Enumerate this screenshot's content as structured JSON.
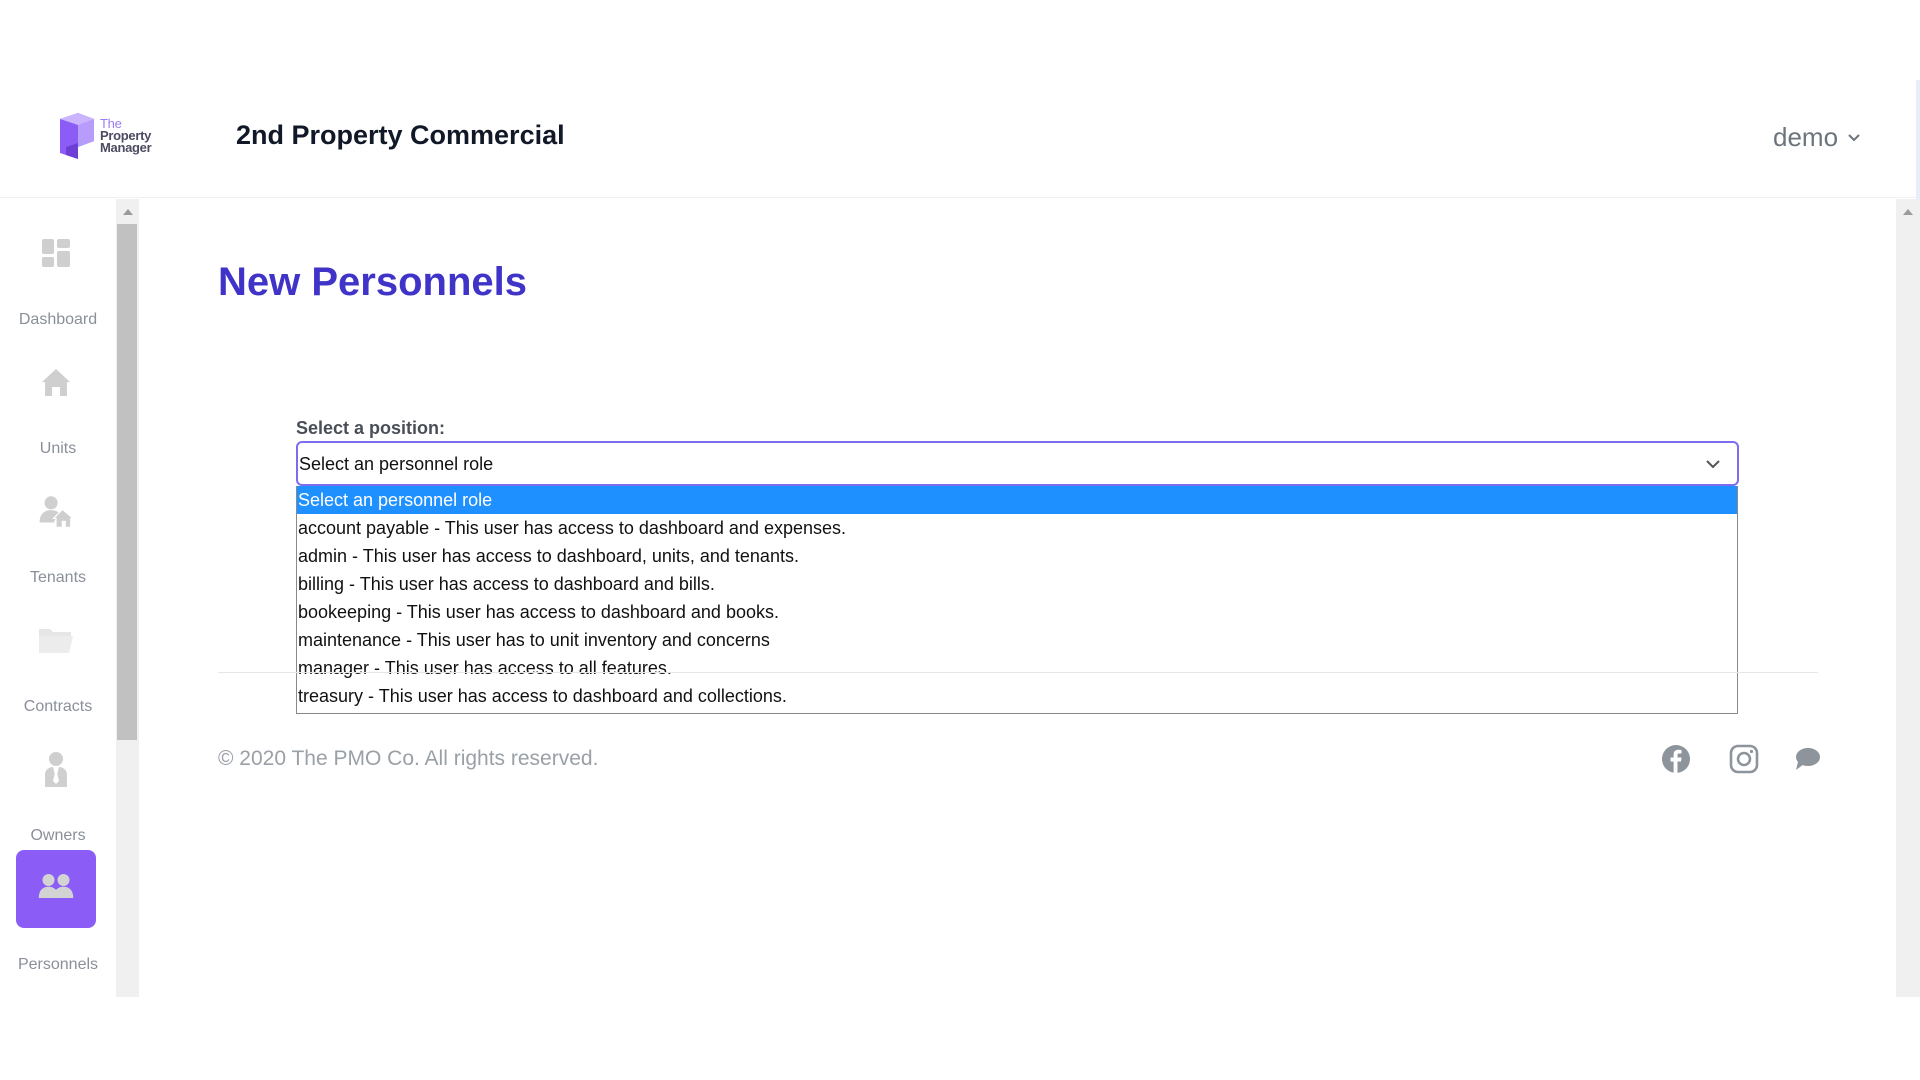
{
  "header": {
    "logo": {
      "line1": "The",
      "line2": "Property",
      "line3": "Manager",
      "icon": "property-manager-logo"
    },
    "title": "2nd Property Commercial",
    "user": {
      "name": "demo",
      "icon": "chevron-down-icon"
    }
  },
  "sidebar": {
    "items": [
      {
        "label": "Dashboard",
        "icon": "dashboard-grid-icon",
        "active": false
      },
      {
        "label": "Units",
        "icon": "home-icon",
        "active": false
      },
      {
        "label": "Tenants",
        "icon": "tenant-house-icon",
        "active": false
      },
      {
        "label": "Contracts",
        "icon": "folder-icon",
        "active": false
      },
      {
        "label": "Owners",
        "icon": "owner-person-icon",
        "active": false
      },
      {
        "label": "Personnels",
        "icon": "users-icon",
        "active": true
      }
    ]
  },
  "main": {
    "title": "New Personnels",
    "form": {
      "position_label": "Select a position:",
      "select_value": "Select an personnel role",
      "options": [
        "Select an personnel role",
        "account payable - This user has access to dashboard and expenses.",
        "admin - This user has access to dashboard, units, and tenants.",
        "billing - This user has access to dashboard and bills.",
        "bookeeping - This user has access to dashboard and books.",
        "maintenance - This user has to unit inventory and concerns",
        "manager - This user has access to all features.",
        "treasury - This user has access to dashboard and collections."
      ],
      "selected_index": 0
    }
  },
  "footer": {
    "copyright": "© 2020 The PMO Co. All rights reserved.",
    "social": [
      "facebook-icon",
      "instagram-icon",
      "chat-icon"
    ]
  },
  "colors": {
    "accent": "#8b5cf6",
    "title": "#3f33c8",
    "select_border": "#7b6cf0",
    "option_highlight": "#1e90ff"
  }
}
